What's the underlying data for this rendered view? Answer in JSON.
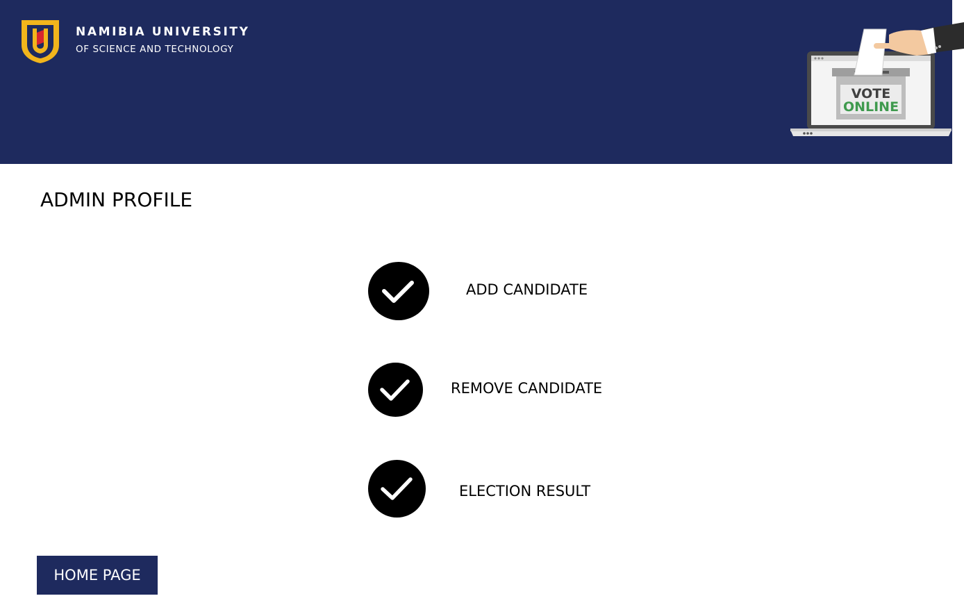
{
  "header": {
    "university_name": "NAMIBIA UNIVERSITY",
    "university_subtitle": "OF SCIENCE AND TECHNOLOGY",
    "logo_icon": "nust-shield-logo",
    "illustration": {
      "icon": "vote-online-laptop-icon",
      "line1": "VOTE",
      "line2": "ONLINE"
    }
  },
  "main": {
    "title": "ADMIN PROFILE",
    "actions": [
      {
        "label": "ADD CANDIDATE",
        "icon": "check-circle-icon"
      },
      {
        "label": "REMOVE CANDIDATE",
        "icon": "check-circle-icon"
      },
      {
        "label": "ELECTION RESULT",
        "icon": "check-circle-icon"
      }
    ]
  },
  "footer": {
    "home_button_label": "HOME PAGE"
  },
  "colors": {
    "header_bg": "#1e2a5e",
    "button_bg": "#1e2a5e",
    "vote_green": "#3f9a4e",
    "logo_gold": "#f2b51c",
    "logo_red": "#d8262e"
  }
}
